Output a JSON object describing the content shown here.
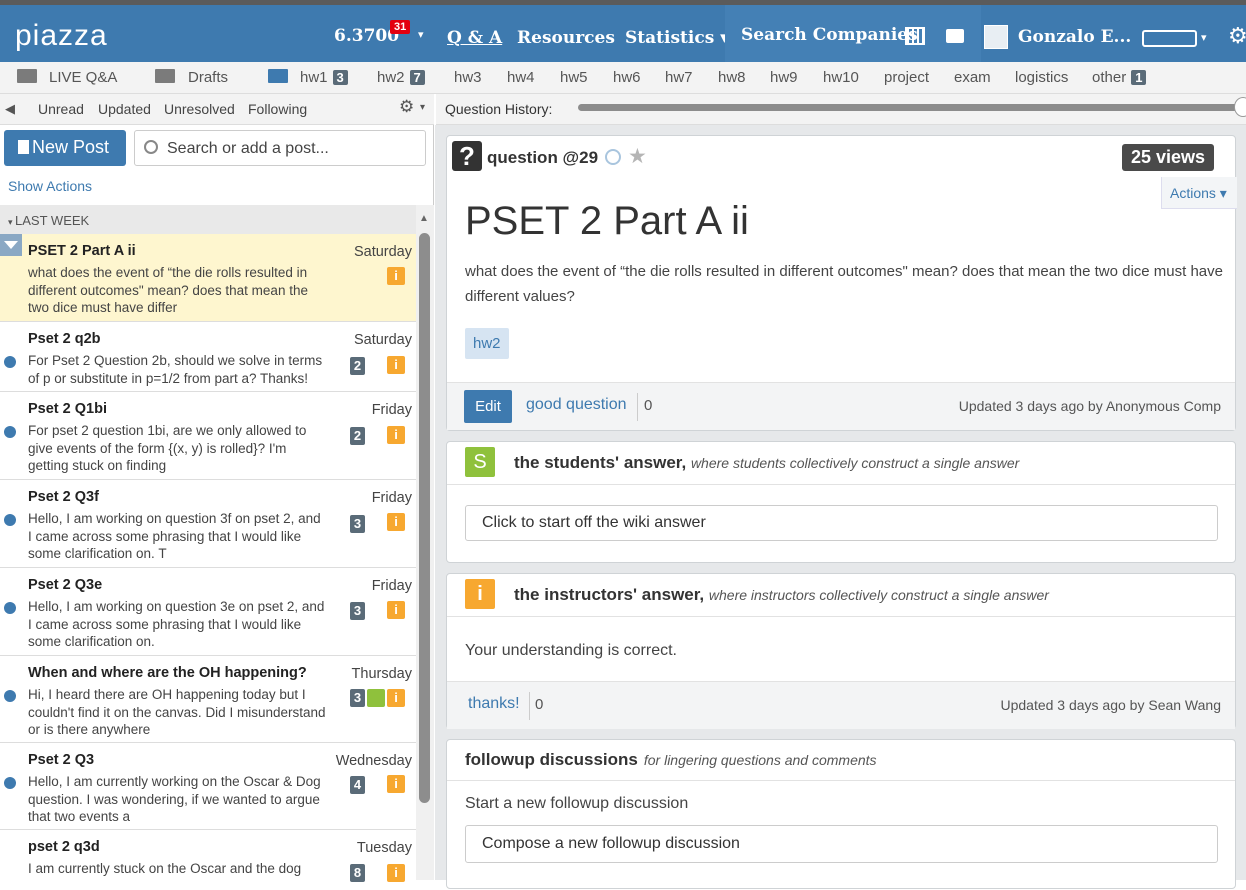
{
  "topbar": {
    "logo": "piazza",
    "course": "6.3700",
    "course_badge": "31",
    "nav_qa": "Q & A",
    "nav_resources": "Resources",
    "nav_statistics": "Statistics ▾",
    "search_companies": "Search Companies",
    "user_name": "Gonzalo E..."
  },
  "folders": {
    "live_qa": "LIVE Q&A",
    "drafts": "Drafts",
    "items": [
      {
        "label": "hw1",
        "count": "3"
      },
      {
        "label": "hw2",
        "count": "7"
      },
      {
        "label": "hw3"
      },
      {
        "label": "hw4"
      },
      {
        "label": "hw5"
      },
      {
        "label": "hw6"
      },
      {
        "label": "hw7"
      },
      {
        "label": "hw8"
      },
      {
        "label": "hw9"
      },
      {
        "label": "hw10"
      },
      {
        "label": "project"
      },
      {
        "label": "exam"
      },
      {
        "label": "logistics"
      },
      {
        "label": "other",
        "count": "1"
      }
    ]
  },
  "filters": {
    "unread": "Unread",
    "updated": "Updated",
    "unresolved": "Unresolved",
    "following": "Following"
  },
  "history": {
    "label": "Question History:"
  },
  "sidebar": {
    "new_post": "New Post",
    "search_placeholder": "Search or add a post...",
    "show_actions": "Show Actions",
    "section": "LAST WEEK",
    "posts": [
      {
        "title": "PSET 2 Part A ii",
        "date": "Saturday",
        "body": "what does the event of “the die rolls resulted in different outcomes\" mean? does that mean the two dice must have differ"
      },
      {
        "title": "Pset 2 q2b",
        "date": "Saturday",
        "count": "2",
        "body": "For Pset 2 Question 2b, should we solve in terms of p or substitute in p=1/2 from part a? Thanks!"
      },
      {
        "title": "Pset 2 Q1bi",
        "date": "Friday",
        "count": "2",
        "body": "For pset 2 question 1bi, are we only allowed to give events of the form {(x, y) is rolled}? I'm getting stuck on finding"
      },
      {
        "title": "Pset 2 Q3f",
        "date": "Friday",
        "count": "3",
        "body": "Hello, I am working on question 3f on pset 2, and I came across some phrasing that I would like some clarification on. T"
      },
      {
        "title": "Pset 2 Q3e",
        "date": "Friday",
        "count": "3",
        "body": "Hello, I am working on question 3e on pset 2, and I came across some phrasing that I would like some clarification on."
      },
      {
        "title": "When and where are the OH happening?",
        "date": "Thursday",
        "count": "3",
        "body": "Hi, I heard there are OH happening today but I couldn't find it on the canvas. Did I misunderstand or is there anywhere"
      },
      {
        "title": "Pset 2 Q3",
        "date": "Wednesday",
        "count": "4",
        "body": "Hello, I am currently working on the Oscar & Dog question. I was wondering, if we wanted to argue that two events a"
      },
      {
        "title": "pset 2 q3d",
        "date": "Tuesday",
        "count": "8",
        "body": "I am currently stuck on the Oscar and the dog"
      }
    ]
  },
  "question": {
    "label": "question @29",
    "views": "25 views",
    "actions": "Actions ▾",
    "title": "PSET 2 Part A ii",
    "text": "what does the event of “the die rolls resulted in different outcomes\" mean? does that mean the two dice must have different values?",
    "tag": "hw2",
    "edit": "Edit",
    "good_question": "good question",
    "good_count": "0",
    "updated": "Updated 3 days ago by Anonymous Comp"
  },
  "students_answer": {
    "icon": "S",
    "title": "the students' answer,",
    "subtitle": "where students collectively construct a single answer",
    "placeholder": "Click to start off the wiki answer"
  },
  "instructors_answer": {
    "icon": "i",
    "title": "the instructors' answer,",
    "subtitle": "where instructors collectively construct a single answer",
    "text": "Your understanding is correct.",
    "thanks": "thanks!",
    "thanks_count": "0",
    "updated": "Updated 3 days ago by Sean Wang"
  },
  "followups": {
    "title": "followup discussions",
    "subtitle": "for lingering questions and comments",
    "start": "Start a new followup discussion",
    "compose": "Compose a new followup discussion"
  }
}
